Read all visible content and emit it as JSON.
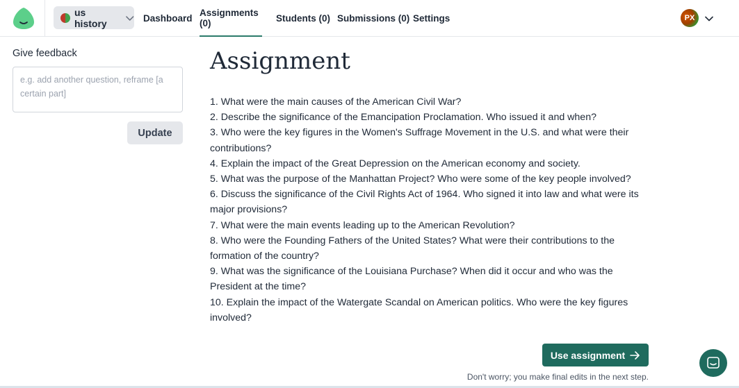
{
  "header": {
    "class_select": {
      "label": "us history"
    },
    "nav": [
      {
        "label": "Dashboard"
      },
      {
        "label": "Assignments (0)"
      },
      {
        "label": "Students (0)"
      },
      {
        "label": "Submissions (0)"
      },
      {
        "label": "Settings"
      }
    ],
    "active_tab": "Assignments (0)",
    "user": {
      "initials": "PX"
    }
  },
  "feedback": {
    "heading": "Give feedback",
    "placeholder": "e.g. add another question, reframe [a certain part]",
    "value": "",
    "update_label": "Update"
  },
  "assignment": {
    "title": "Assignment",
    "questions": [
      "1. What were the main causes of the American Civil War?",
      "2. Describe the significance of the Emancipation Proclamation. Who issued it and when?",
      "3. Who were the key figures in the Women's Suffrage Movement in the U.S. and what were their contributions?",
      "4. Explain the impact of the Great Depression on the American economy and society.",
      "5. What was the purpose of the Manhattan Project? Who were some of the key people involved?",
      "6. Discuss the significance of the Civil Rights Act of 1964. Who signed it into law and what were its major provisions?",
      "7. What were the main events leading up to the American Revolution?",
      "8. Who were the Founding Fathers of the United States? What were their contributions to the formation of the country?",
      "9. What was the significance of the Louisiana Purchase? When did it occur and who was the President at the time?",
      "10. Explain the impact of the Watergate Scandal on American politics. Who were the key figures involved?"
    ],
    "use_label": "Use assignment",
    "footnote": "Don't worry; you make final edits in the next step."
  },
  "icons": {
    "logo": "logo-icon",
    "chevron": "chevron-down-icon",
    "arrow": "arrow-right-icon",
    "chat": "chat-icon"
  },
  "colors": {
    "brand": "#1f6b5e",
    "logo": "#5ccf8a",
    "active_underline": "#2a7a6a"
  }
}
